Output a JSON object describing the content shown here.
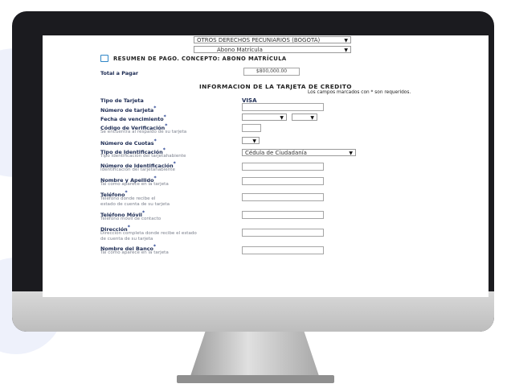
{
  "header": {
    "concept_select": "OTROS DERECHOS PECUNIARIOS (BOGOTÁ)",
    "sub_select": "Abono Matrícula",
    "summary_title": "RESUMEN DE PAGO. CONCEPTO: ABONO MATRÍCULA",
    "total_label": "Total a Pagar",
    "total_value": "$800,000.00"
  },
  "card_section": {
    "title": "INFORMACION DE LA TARJETA DE CREDITO",
    "required_note": "Los campos marcados con * son requeridos.",
    "card_type_label": "Tipo de Tarjeta",
    "card_type_value": "VISA"
  },
  "fields": {
    "card_number": {
      "label": "Número de tarjeta",
      "req": "*"
    },
    "expiry": {
      "label": "Fecha de vencimiento",
      "req": "*"
    },
    "cvv": {
      "label": "Código de Verificación",
      "req": "*",
      "hint": "Se encuentra al respaldo de su tarjeta"
    },
    "installments": {
      "label": "Número de Cuotas",
      "req": "*"
    },
    "id_type": {
      "label": "Tipo de Identificación",
      "req": "*",
      "hint": "Tipo Identificación del tarjetahabiente",
      "value": "Cédula de Ciudadanía"
    },
    "id_number": {
      "label": "Número de Identificación",
      "req": "*",
      "hint": "Identificación del tarjetahabiente"
    },
    "name": {
      "label": "Nombre y Apellido",
      "req": "*",
      "hint": "Tal como aparece en la tarjeta"
    },
    "phone": {
      "label": "Teléfono",
      "req": "*",
      "hint1": "Teléfono donde recibe el",
      "hint2": "estado de cuenta de su tarjeta"
    },
    "mobile": {
      "label": "Teléfono Móvil",
      "req": "*",
      "hint": "Teléfono móvil de contacto"
    },
    "address": {
      "label": "Dirección",
      "req": "*",
      "hint1": "Dirección completa donde recibe el estado",
      "hint2": "de cuenta de su tarjeta"
    },
    "bank": {
      "label": "Nombre del Banco",
      "req": "*",
      "hint": "Tal como aparece en la tarjeta"
    }
  },
  "icons": {
    "summary": "document-icon",
    "dropdown": "caret-down-icon"
  },
  "colors": {
    "bezel": "#1b1b1f",
    "label": "#1b2a52",
    "accent": "#2f86c7"
  }
}
